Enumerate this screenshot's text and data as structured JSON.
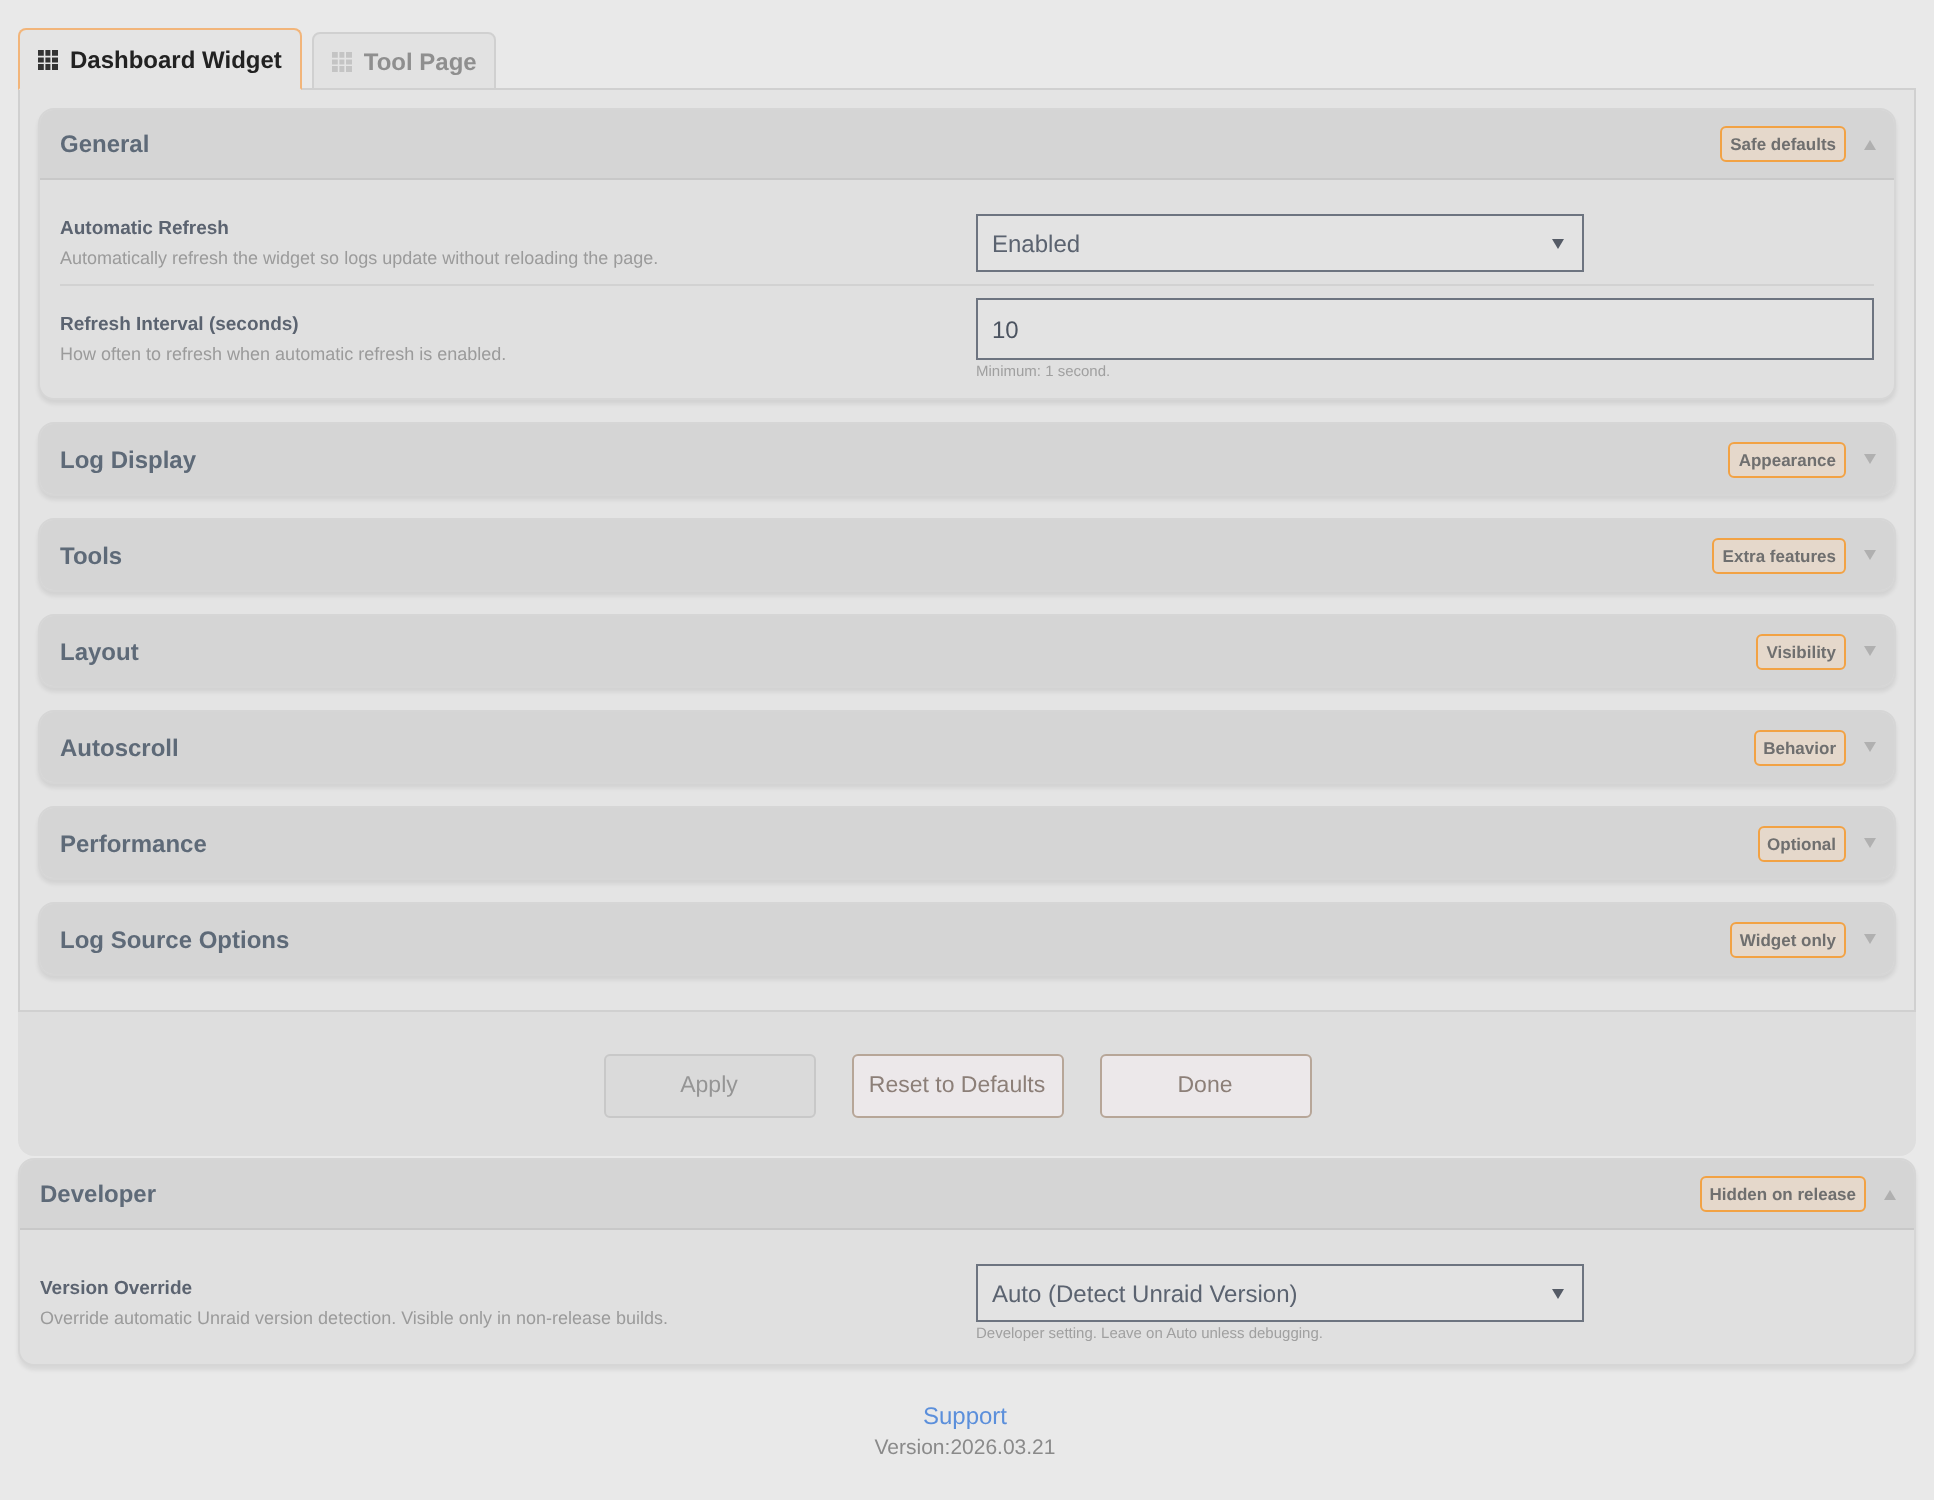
{
  "tabs": [
    {
      "label": "Dashboard Widget",
      "selected": true
    },
    {
      "label": "Tool Page",
      "selected": false
    }
  ],
  "sections": [
    {
      "title": "General",
      "badge": "Safe defaults",
      "expanded": true,
      "settings": [
        {
          "kind": "select",
          "label": "Automatic Refresh",
          "description": "Automatically refresh the widget so logs update without reloading the page.",
          "value": "Enabled"
        },
        {
          "kind": "input",
          "label": "Refresh Interval (seconds)",
          "description": "How often to refresh when automatic refresh is enabled.",
          "value": "10",
          "hint": "Minimum: 1 second."
        }
      ]
    },
    {
      "title": "Log Display",
      "badge": "Appearance",
      "expanded": false
    },
    {
      "title": "Tools",
      "badge": "Extra features",
      "expanded": false
    },
    {
      "title": "Layout",
      "badge": "Visibility",
      "expanded": false
    },
    {
      "title": "Autoscroll",
      "badge": "Behavior",
      "expanded": false
    },
    {
      "title": "Performance",
      "badge": "Optional",
      "expanded": false
    },
    {
      "title": "Log Source Options",
      "badge": "Widget only",
      "expanded": false
    }
  ],
  "buttons": [
    {
      "label": "Apply",
      "disabled": true
    },
    {
      "label": "Reset to Defaults",
      "disabled": false
    },
    {
      "label": "Done",
      "disabled": false
    }
  ],
  "developer": {
    "title": "Developer",
    "badge": "Hidden on release",
    "expanded": true,
    "settings": [
      {
        "kind": "select",
        "label": "Version Override",
        "description": "Override automatic Unraid version detection. Visible only in non-release builds.",
        "value": "Auto (Detect Unraid Version)",
        "hint": "Developer setting. Leave on Auto unless debugging."
      }
    ]
  },
  "footer": {
    "link": "Support",
    "version": "Version:2026.03.21"
  }
}
